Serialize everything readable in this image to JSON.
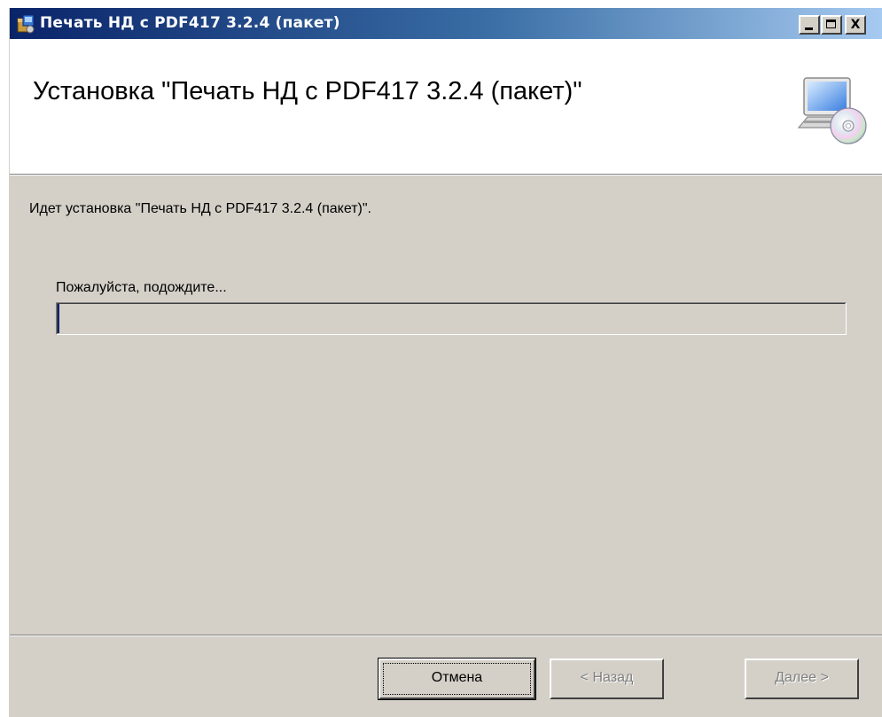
{
  "window": {
    "title": "Печать НД с PDF417 3.2.4 (пакет)"
  },
  "titlebar_buttons": {
    "minimize": "_",
    "maximize": "□",
    "close": "X"
  },
  "banner": {
    "title": "Установка \"Печать НД с PDF417 3.2.4 (пакет)\""
  },
  "body": {
    "status_text": "Идет установка \"Печать НД с PDF417 3.2.4 (пакет)\".",
    "wait_text": "Пожалуйста, подождите...",
    "progress_fraction": 0.0
  },
  "buttons": {
    "cancel": "Отмена",
    "back": "< Назад",
    "next": "Далее >"
  },
  "colors": {
    "titlebar_start": "#0a246a",
    "titlebar_end": "#a6caf0",
    "dialog_bg": "#d4d0c8"
  }
}
